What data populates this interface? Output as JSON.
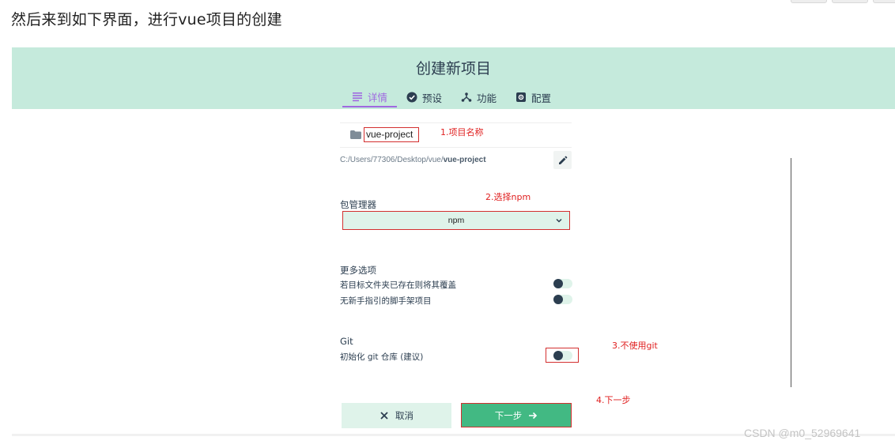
{
  "intro": "然后来到如下界面，进行vue项目的创建",
  "header": {
    "title": "创建新项目"
  },
  "tabs": [
    {
      "label": "详情",
      "active": true
    },
    {
      "label": "预设",
      "active": false
    },
    {
      "label": "功能",
      "active": false
    },
    {
      "label": "配置",
      "active": false
    }
  ],
  "project": {
    "name": "vue-project",
    "path_prefix": "C:/Users/77306/Desktop/vue/",
    "path_name": "vue-project"
  },
  "package_manager": {
    "label": "包管理器",
    "value": "npm"
  },
  "more_options": {
    "label": "更多选项",
    "items": [
      {
        "label": "若目标文件夹已存在则将其覆盖",
        "enabled": false
      },
      {
        "label": "无新手指引的脚手架项目",
        "enabled": false
      }
    ]
  },
  "git": {
    "label": "Git",
    "init_label": "初始化 git 仓库 (建议)",
    "enabled": false
  },
  "buttons": {
    "cancel": "取消",
    "next": "下一步"
  },
  "annotations": {
    "a1": "1.项目名称",
    "a2": "2.选择npm",
    "a3": "3.不使用git",
    "a4": "4.下一步"
  },
  "watermark": "CSDN @m0_52969641",
  "colors": {
    "accent": "#42b983",
    "header_bg": "#c5eadc",
    "tab_active": "#a06ae0",
    "annotation": "#e02020"
  }
}
